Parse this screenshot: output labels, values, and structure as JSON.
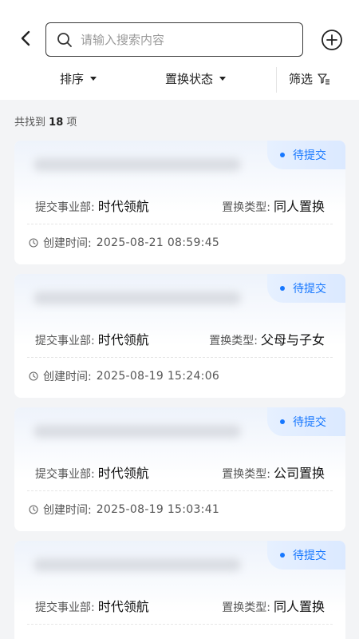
{
  "search": {
    "placeholder": "请输入搜索内容"
  },
  "filters": {
    "sort_label": "排序",
    "status_label": "置换状态",
    "filter_label": "筛选"
  },
  "results": {
    "prefix": "共找到",
    "count": "18",
    "suffix": "项"
  },
  "labels": {
    "dept": "提交事业部:",
    "type": "置换类型:",
    "created": "创建时间:"
  },
  "cards": [
    {
      "status": "待提交",
      "dept": "时代领航",
      "type": "同人置换",
      "created": "2025-08-21 08:59:45"
    },
    {
      "status": "待提交",
      "dept": "时代领航",
      "type": "父母与子女",
      "created": "2025-08-19 15:24:06"
    },
    {
      "status": "待提交",
      "dept": "时代领航",
      "type": "公司置换",
      "created": "2025-08-19 15:03:41"
    },
    {
      "status": "待提交",
      "dept": "时代领航",
      "type": "同人置换",
      "created": ""
    }
  ],
  "colors": {
    "accent": "#1677ff",
    "badge_bg": "#e6f0ff"
  }
}
